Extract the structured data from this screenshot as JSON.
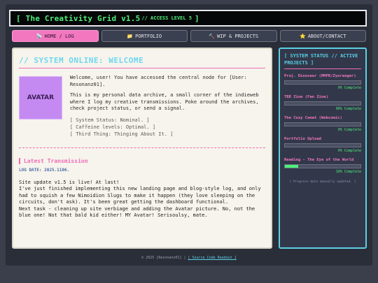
{
  "header": {
    "title": "[ The Creativity Grid v1.5",
    "sub": "// ACCESS LEVEL 5",
    "close": "]"
  },
  "nav": [
    {
      "icon": "📡",
      "label": "HOME / LOG",
      "active": true
    },
    {
      "icon": "📁",
      "label": "PORTFOLIO",
      "active": false
    },
    {
      "icon": "🔨",
      "label": "WIP & PROJECTS",
      "active": false
    },
    {
      "icon": "⭐",
      "label": "ABOUT/CONTACT",
      "active": false
    }
  ],
  "main": {
    "title": "// SYSTEM ONLINE: WELCOME",
    "avatar_label": "AVATAR",
    "welcome": "Welcome, user! You have accessed the central node for [User: Resonanz01].",
    "about": "This is my personal data archive, a small corner of the indieweb where I log my creative transmissions. Poke around the archives, check project status, or send a signal.",
    "status_lines": [
      "[ System Status: Nominal. ]",
      "[ Caffeine levels: Optimal. ]",
      "[ Third Thing: Thinging About It. ]"
    ],
    "latest_title": "Latest Transmission",
    "log_date": "LOG DATE: 2025.1106.",
    "log_lines": [
      "Site update v1.5 is live! At last!",
      "I've just finished implementing this new landing page and blog-style log, and only had to squish a few Nimoidion Slugs to make it happen (they love sleeping on the circuits, don't ask). It's been great getting the dashboard functional.",
      "Next task - cleaning up site verbiage and adding the Avatar picture. No, not the blue one! Not that bald kid either! MY Avatar! Serisoulsy, mate."
    ]
  },
  "sidebar": {
    "title": "[ SYSTEM STATUS // ACTIVE PROJECTS ]",
    "projects": [
      {
        "name": "Proj. Dinosaur (MMPR/Zyuranger)",
        "progress": 0.0,
        "label": "0% Complete"
      },
      {
        "name": "TBD Zine (Fan Zine)",
        "progress": 0.0,
        "label": "00% Complete"
      },
      {
        "name": "The Cozy Comet (Webcomic)",
        "progress": 0.0,
        "label": "0% Complete"
      },
      {
        "name": "Portfolio Upload",
        "progress": 0.0,
        "label": "0% Complete"
      },
      {
        "name": "Reading - The Eye of the World",
        "progress": 0.18,
        "label": "18% Complete"
      }
    ],
    "footnote": "[ Progress data manually updated. ]"
  },
  "footer": {
    "copyright": "© 2025 [Resonanz01] |",
    "link": "[ Source Code Readout ]"
  },
  "colors": {
    "accent_pink": "#f277bf",
    "accent_cyan": "#5ccfe6",
    "accent_green": "#4ef07a"
  }
}
